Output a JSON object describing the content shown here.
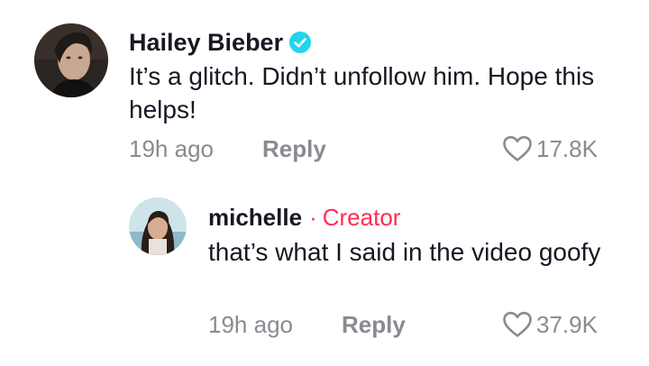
{
  "comments": [
    {
      "username": "Hailey Bieber",
      "verified": true,
      "text": "It’s a glitch. Didn’t unfollow him. Hope this helps!",
      "time": "19h ago",
      "reply_label": "Reply",
      "likes": "17.8K"
    },
    {
      "username": "michelle",
      "badge_separator": "·",
      "badge": "Creator",
      "text": "that’s what I said in the video goofy",
      "time": "19h ago",
      "reply_label": "Reply",
      "likes": "37.9K"
    }
  ],
  "colors": {
    "accent_creator": "#fe2c55",
    "verified_badge": "#20d5ec",
    "meta_text": "#8a8b91",
    "primary_text": "#161823"
  },
  "icons": {
    "verified": "verified-check-icon",
    "like": "heart-outline-icon"
  }
}
